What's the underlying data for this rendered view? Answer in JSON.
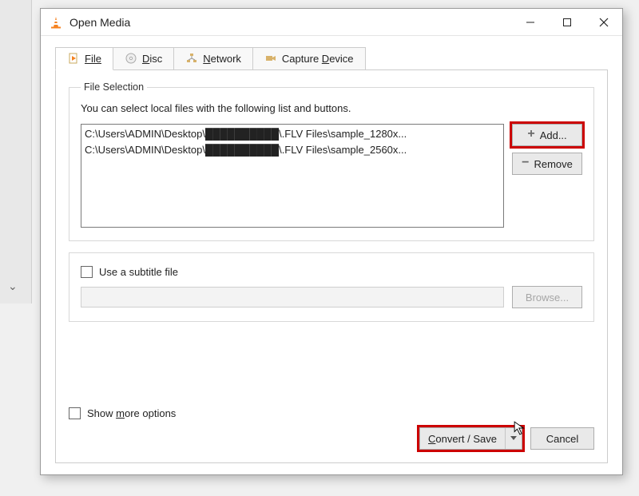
{
  "window": {
    "title": "Open Media"
  },
  "tabs": {
    "file": "File",
    "disc": "Disc",
    "network": "Network",
    "capture": "Capture Device"
  },
  "fileSelection": {
    "legend": "File Selection",
    "hint": "You can select local files with the following list and buttons.",
    "files": [
      "C:\\Users\\ADMIN\\Desktop\\██████████\\.FLV Files\\sample_1280x...",
      "C:\\Users\\ADMIN\\Desktop\\██████████\\.FLV Files\\sample_2560x..."
    ],
    "add": "Add...",
    "remove": "Remove"
  },
  "subtitle": {
    "label": "Use a subtitle file",
    "browse": "Browse..."
  },
  "moreOptions": "Show more options",
  "footer": {
    "convert": "Convert / Save",
    "cancel": "Cancel"
  }
}
